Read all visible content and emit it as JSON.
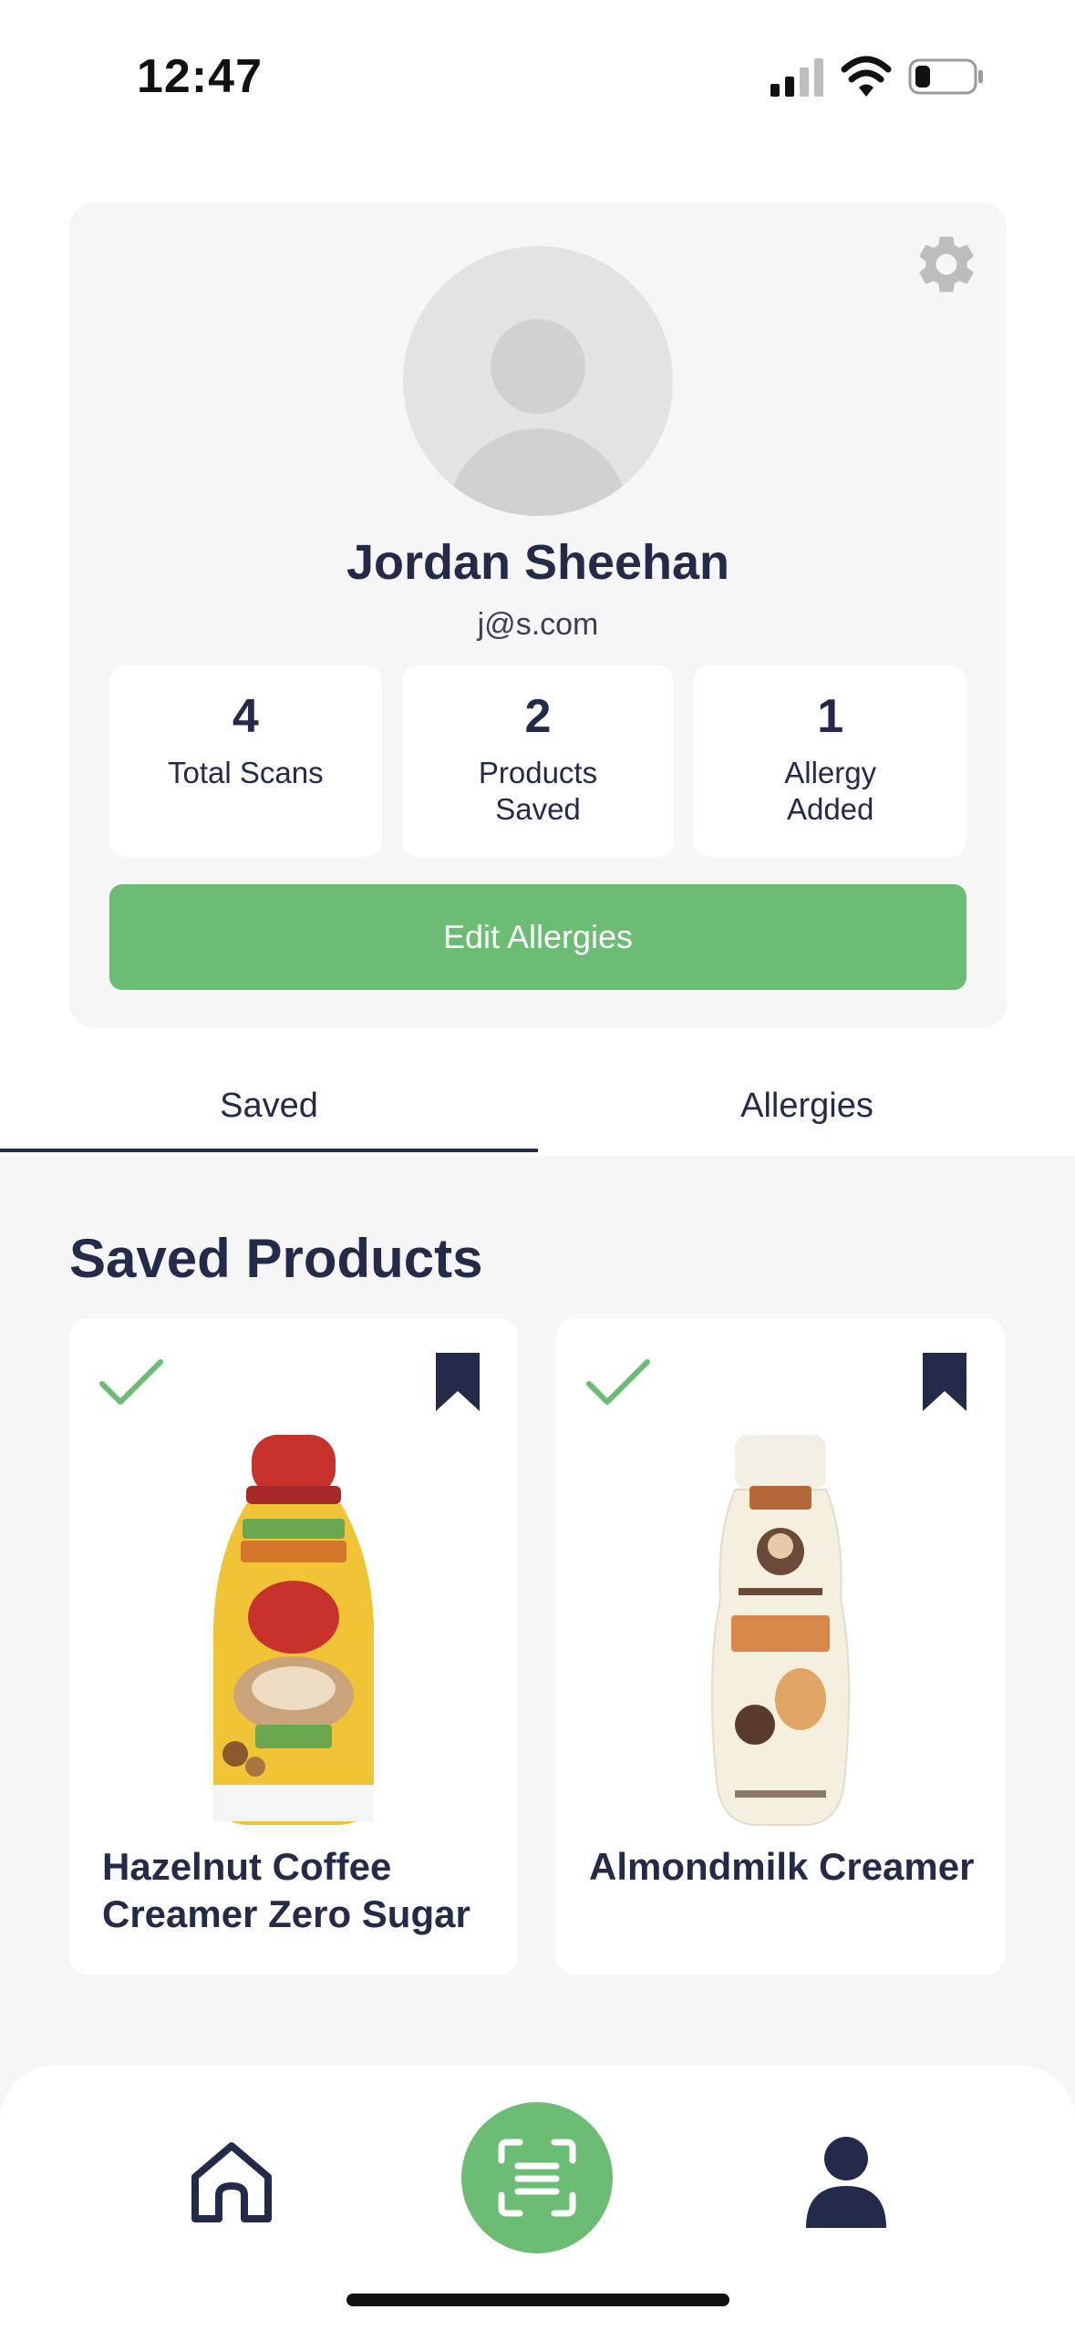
{
  "status_bar": {
    "time": "12:47",
    "icons": [
      "signal-icon",
      "wifi-icon",
      "battery-icon"
    ]
  },
  "profile": {
    "name": "Jordan Sheehan",
    "email": "j@s.com",
    "stats": [
      {
        "value": "4",
        "label": "Total Scans"
      },
      {
        "value": "2",
        "label": "Products Saved"
      },
      {
        "value": "1",
        "label": "Allergy Added"
      }
    ],
    "edit_button_label": "Edit Allergies"
  },
  "tabs": {
    "items": [
      {
        "label": "Saved",
        "active": true
      },
      {
        "label": "Allergies",
        "active": false
      }
    ]
  },
  "saved": {
    "title": "Saved Products",
    "products": [
      {
        "name": "Hazelnut Coffee Creamer Zero Sugar",
        "status_icon": "check-icon",
        "saved_icon": "bookmark-icon"
      },
      {
        "name": "Almondmilk Creamer",
        "status_icon": "check-icon",
        "saved_icon": "bookmark-icon"
      }
    ]
  },
  "bottom_nav": {
    "items": [
      "home-icon",
      "scan-icon",
      "profile-icon"
    ],
    "active": "profile-icon"
  },
  "colors": {
    "primary_green": "#6bbd74",
    "navy": "#232a4a",
    "card_bg": "#f6f6f6"
  }
}
